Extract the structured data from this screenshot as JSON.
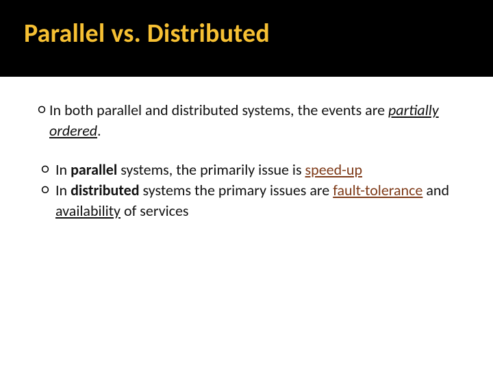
{
  "title": "Parallel vs. Distributed",
  "bullets": {
    "b1": {
      "pre": "In both parallel and distributed systems, the events are ",
      "em": "partially ordered",
      "post": "."
    },
    "b2": {
      "t1": " In ",
      "t2": "parallel",
      "t3": " systems, the primarily issue is ",
      "t4": "speed-up"
    },
    "b3": {
      "t1": " In ",
      "t2": "distributed",
      "t3": " systems the primary issues are ",
      "t4": "fault-tolerance",
      "t5": " and ",
      "t6": "availability",
      "t7": " of services"
    }
  }
}
